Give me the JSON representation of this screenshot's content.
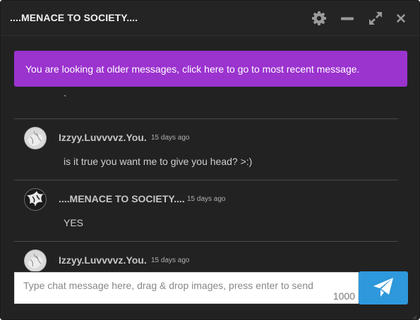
{
  "window": {
    "title": "....MENACE TO SOCIETY....",
    "controls": [
      "gear-icon",
      "minimize-icon",
      "expand-icon",
      "close-icon"
    ]
  },
  "banner": {
    "text": "You are looking at older messages, click here to go to most recent message.",
    "color": "#9b33cf"
  },
  "messages": {
    "partial_text": "`",
    "items": [
      {
        "username": "Izzyy.Luvvvvz.You.",
        "timestamp": "15 days ago",
        "text": "is it true you want me to give you head? >:)"
      },
      {
        "username": "....MENACE TO SOCIETY....",
        "timestamp": "15 days ago",
        "text": "YES"
      },
      {
        "username": "Izzyy.Luvvvvz.You.",
        "timestamp": "15 days ago",
        "text": ""
      }
    ]
  },
  "composer": {
    "placeholder": "Type chat message here, drag & drop images, press enter to send",
    "value": "",
    "char_limit": "1000"
  },
  "send_button": {
    "icon": "paper-plane-icon",
    "color": "#2e98dc"
  }
}
